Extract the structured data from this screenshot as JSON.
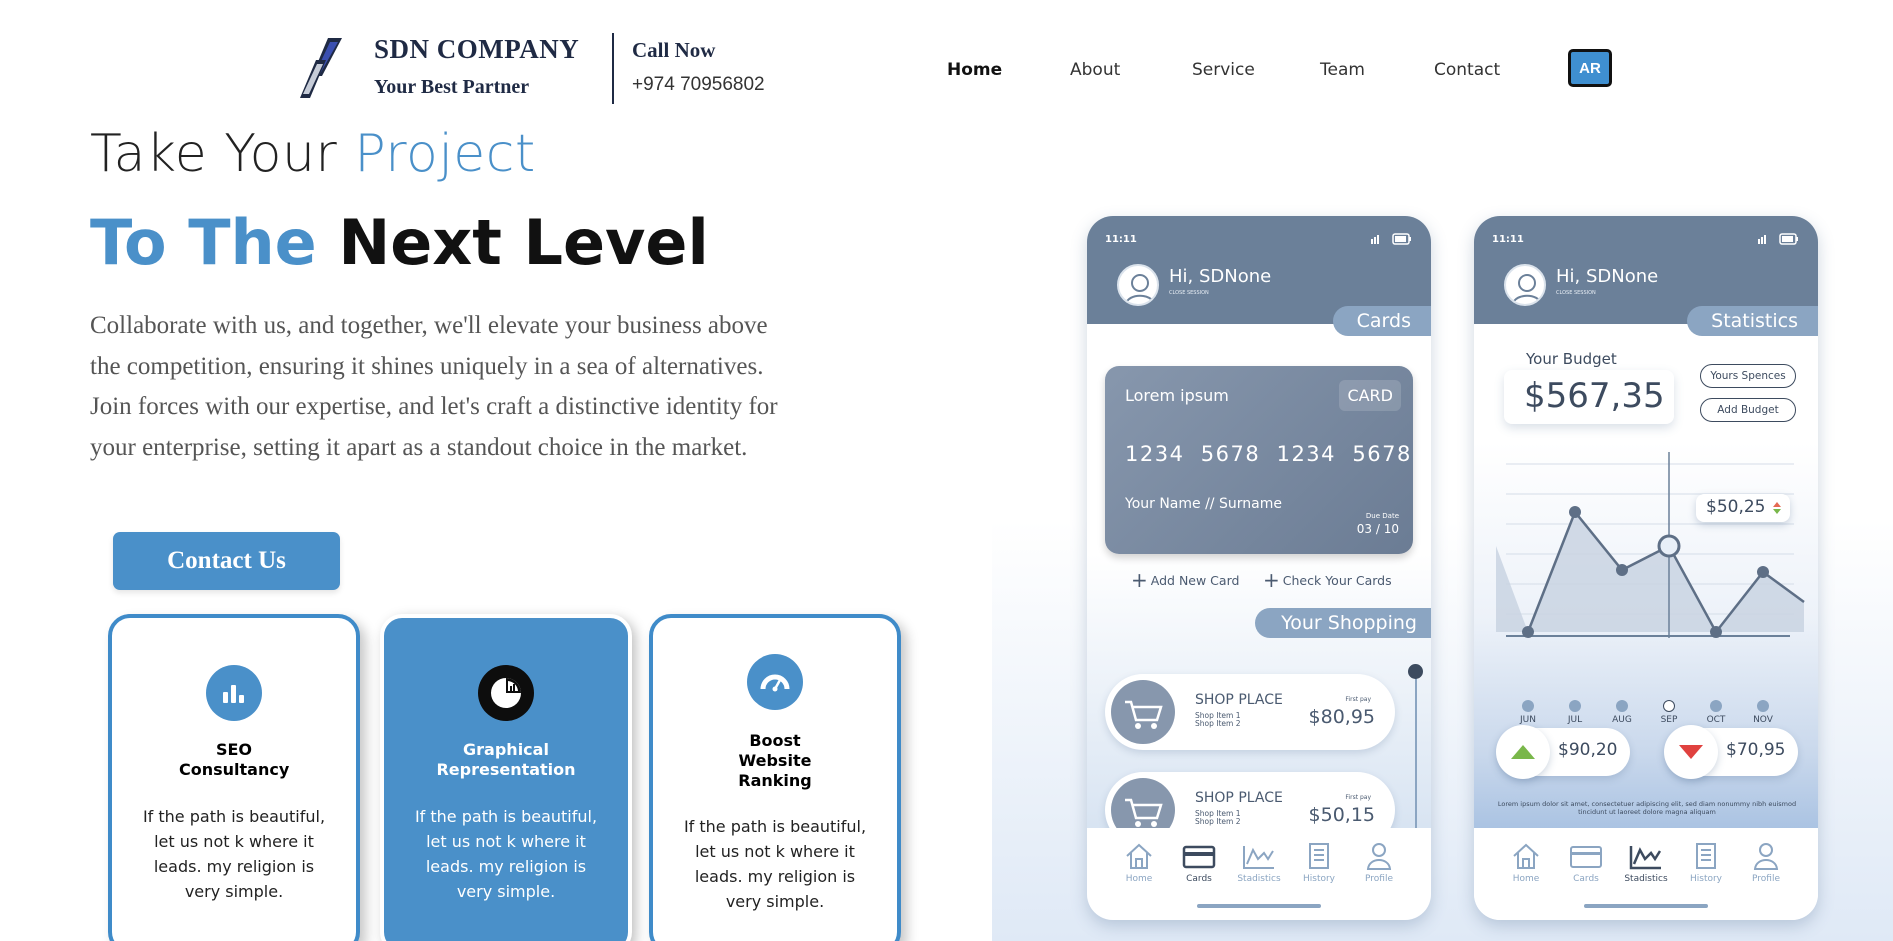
{
  "header": {
    "brand_name": "SDN COMPANY",
    "brand_tagline": "Your Best Partner",
    "call_label": "Call Now",
    "call_number": "+974 70956802",
    "nav": [
      "Home",
      "About",
      "Service",
      "Team",
      "Contact"
    ],
    "active_nav": "Home",
    "lang_button": "AR"
  },
  "hero": {
    "line1_plain": "Take Your ",
    "line1_accent": "Project",
    "line2_accent": "To The ",
    "line2_plain": "Next Level",
    "description": "Collaborate with us, and together, we'll elevate your business above the competition, ensuring it shines uniquely in a sea of alternatives. Join forces with our expertise, and let's craft a distinctive identity for your enterprise, setting it apart as a standout choice in the market.",
    "cta": "Contact Us"
  },
  "services": [
    {
      "title": "SEO Consultancy",
      "text": "If the path is beautiful, let us not k where it leads. my religion is very simple.",
      "icon": "bar-chart-icon"
    },
    {
      "title": "Graphical Representation",
      "text": "If the path is beautiful, let us not k where it leads. my religion is very simple.",
      "icon": "pie-chart-icon"
    },
    {
      "title": "Boost Website Ranking",
      "text": "If the path is beautiful, let us not k where it leads. my religion is very simple.",
      "icon": "speedometer-icon"
    }
  ],
  "phone_cards": {
    "time": "11:11",
    "greeting": "Hi, SDNone",
    "close_session": "CLOSE SESSION",
    "section": "Cards",
    "card_label": "Lorem ipsum",
    "card_badge": "CARD",
    "card_number": "1234  5678  1234  5678",
    "card_holder": "Your Name // Surname",
    "due_label": "Due Date",
    "due_value": "03 / 10",
    "add_card": "Add New Card",
    "check_cards": "Check Your Cards",
    "shopping_title": "Your Shopping",
    "shops": [
      {
        "name": "SHOP PLACE",
        "item1": "Shop Item 1",
        "item2": "Shop Item 2",
        "first_pay": "First pay",
        "price": "$80,95"
      },
      {
        "name": "SHOP PLACE",
        "item1": "Shop Item 1",
        "item2": "Shop Item 2",
        "first_pay": "First pay",
        "price": "$50,15"
      }
    ],
    "active_tab": "Cards"
  },
  "phone_stats": {
    "time": "11:11",
    "greeting": "Hi, SDNone",
    "close_session": "CLOSE SESSION",
    "section": "Statistics",
    "budget_label": "Your Budget",
    "budget_value": "$567,35",
    "yours_spences": "Yours Spences",
    "add_budget": "Add Budget",
    "tooltip_value": "$50,25",
    "months": [
      "JUN",
      "JUL",
      "AUG",
      "SEP",
      "OCT",
      "NOV"
    ],
    "selected_month": "SEP",
    "up_value": "$90,20",
    "down_value": "$70,95",
    "note": "Lorem ipsum dolor sit amet, consectetuer adipiscing elit, sed diam nonummy nibh euismod tincidunt ut laoreet dolore magna aliquam",
    "active_tab": "Stadistics"
  },
  "tabs": [
    "Home",
    "Cards",
    "Stadistics",
    "History",
    "Profile"
  ],
  "colors": {
    "accent": "#4a90c9",
    "dark": "#1f2a44",
    "phone_slate": "#6b8099",
    "phone_light": "#8ba5c2"
  }
}
